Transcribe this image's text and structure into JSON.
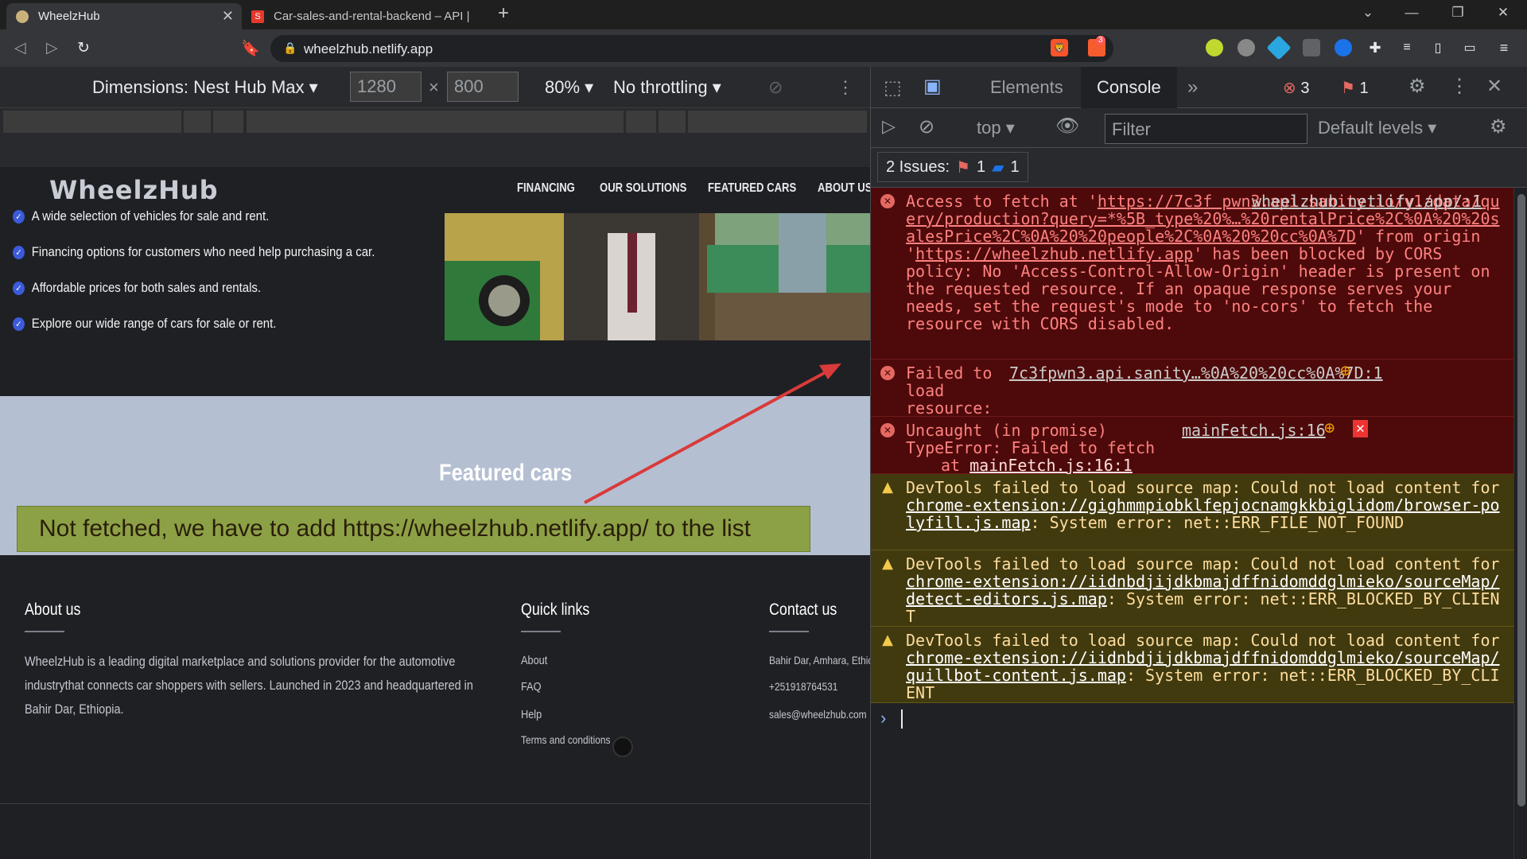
{
  "browser": {
    "tabs": [
      {
        "title": "WheelzHub",
        "active": true
      },
      {
        "title": "Car-sales-and-rental-backend – API | S",
        "active": false
      }
    ],
    "url": "wheelzhub.netlify.app",
    "extension_badge": "3"
  },
  "device_toolbar": {
    "dimensions_label": "Dimensions: Nest Hub Max",
    "width": "1280",
    "height": "800",
    "times": "×",
    "zoom": "80%",
    "throttling": "No throttling"
  },
  "site": {
    "brand": "WheelzHub",
    "nav": [
      "FINANCING",
      "OUR SOLUTIONS",
      "FEATURED CARS",
      "ABOUT US"
    ],
    "features": [
      "A wide selection of vehicles for sale and rent.",
      "Financing options for customers who need help purchasing a car.",
      "Affordable prices for both sales and rentals.",
      "Explore our wide range of cars for sale or rent."
    ],
    "featured_title": "Featured cars",
    "annotation": "Not fetched, we have to add https://wheelzhub.netlify.app/ to the list",
    "footer": {
      "about": {
        "heading": "About us",
        "lines": [
          "WheelzHub is a leading digital marketplace and solutions provider for the automotive",
          "industrythat connects car shoppers with sellers. Launched in 2023 and headquartered in",
          "Bahir Dar, Ethiopia."
        ]
      },
      "quick_links": {
        "heading": "Quick links",
        "items": [
          "About",
          "FAQ",
          "Help",
          "Terms and conditions"
        ]
      },
      "contact": {
        "heading": "Contact us",
        "items": [
          "Bahir Dar, Amhara, Ethic",
          "+251918764531",
          "sales@wheelzhub.com"
        ]
      }
    }
  },
  "devtools": {
    "tabs": [
      "Elements",
      "Console"
    ],
    "more": "»",
    "error_count": "3",
    "issue_count": "1",
    "context": "top",
    "filter_placeholder": "Filter",
    "levels": "Default levels",
    "issues_label": "2 Issues:",
    "issues_err": "1",
    "issues_info": "1",
    "messages": [
      {
        "level": "error",
        "text_a": "Access to fetch at '",
        "link1": "https://7c3f pwn3.api.sanity.io/v1/data/query/production?query=*%5B_type%20%…%20rentalPrice%2C%0A%20%20salesPrice%2C%0A%20%20people%2C%0A%20%20cc%0A%7D",
        "text_b": "' from origin '",
        "link2": "https://wheelzhub.netlify.app",
        "text_c": "' has been blocked by CORS policy: No 'Access-Control-Allow-Origin' header is present on the requested resource. If an opaque response serves your needs, set the request's mode to 'no-cors' to fetch the resource with CORS disabled.",
        "source": "wheelzhub.netlify.app/:1"
      },
      {
        "level": "error",
        "text": "Failed to load resource: net::ERR_FAILED",
        "source": "7c3fpwn3.api.sanity…%0A%20%20cc%0A%7D:1"
      },
      {
        "level": "error",
        "text": "Uncaught (in promise) TypeError: Failed to fetch",
        "at": "at ",
        "at_link": "mainFetch.js:16:1",
        "source": "mainFetch.js:16"
      },
      {
        "level": "warning",
        "text_a": "DevTools failed to load source map: Could not load content for ",
        "link": "chrome-extension://gighmmpiobklfepjocnamgkkbiglidom/browser-polyfill.js.map",
        "text_b": ": System error: net::ERR_FILE_NOT_FOUND"
      },
      {
        "level": "warning",
        "text_a": "DevTools failed to load source map: Could not load content for ",
        "link": "chrome-extension://iidnbdjijdkbmajdffnidomddglmieko/sourceMap/detect-editors.js.map",
        "text_b": ": System error: net::ERR_BLOCKED_BY_CLIENT"
      },
      {
        "level": "warning",
        "text_a": "DevTools failed to load source map: Could not load content for ",
        "link": "chrome-extension://iidnbdjijdkbmajdffnidomddglmieko/sourceMap/quillbot-content.js.map",
        "text_b": ": System error: net::ERR_BLOCKED_BY_CLIENT"
      }
    ],
    "prompt": "›"
  },
  "colors": {
    "annotation_bg": "#8ca145",
    "error_bg": "#4e0a0a",
    "warning_bg": "#413a0f",
    "featured_band": "#b5bfd2"
  }
}
